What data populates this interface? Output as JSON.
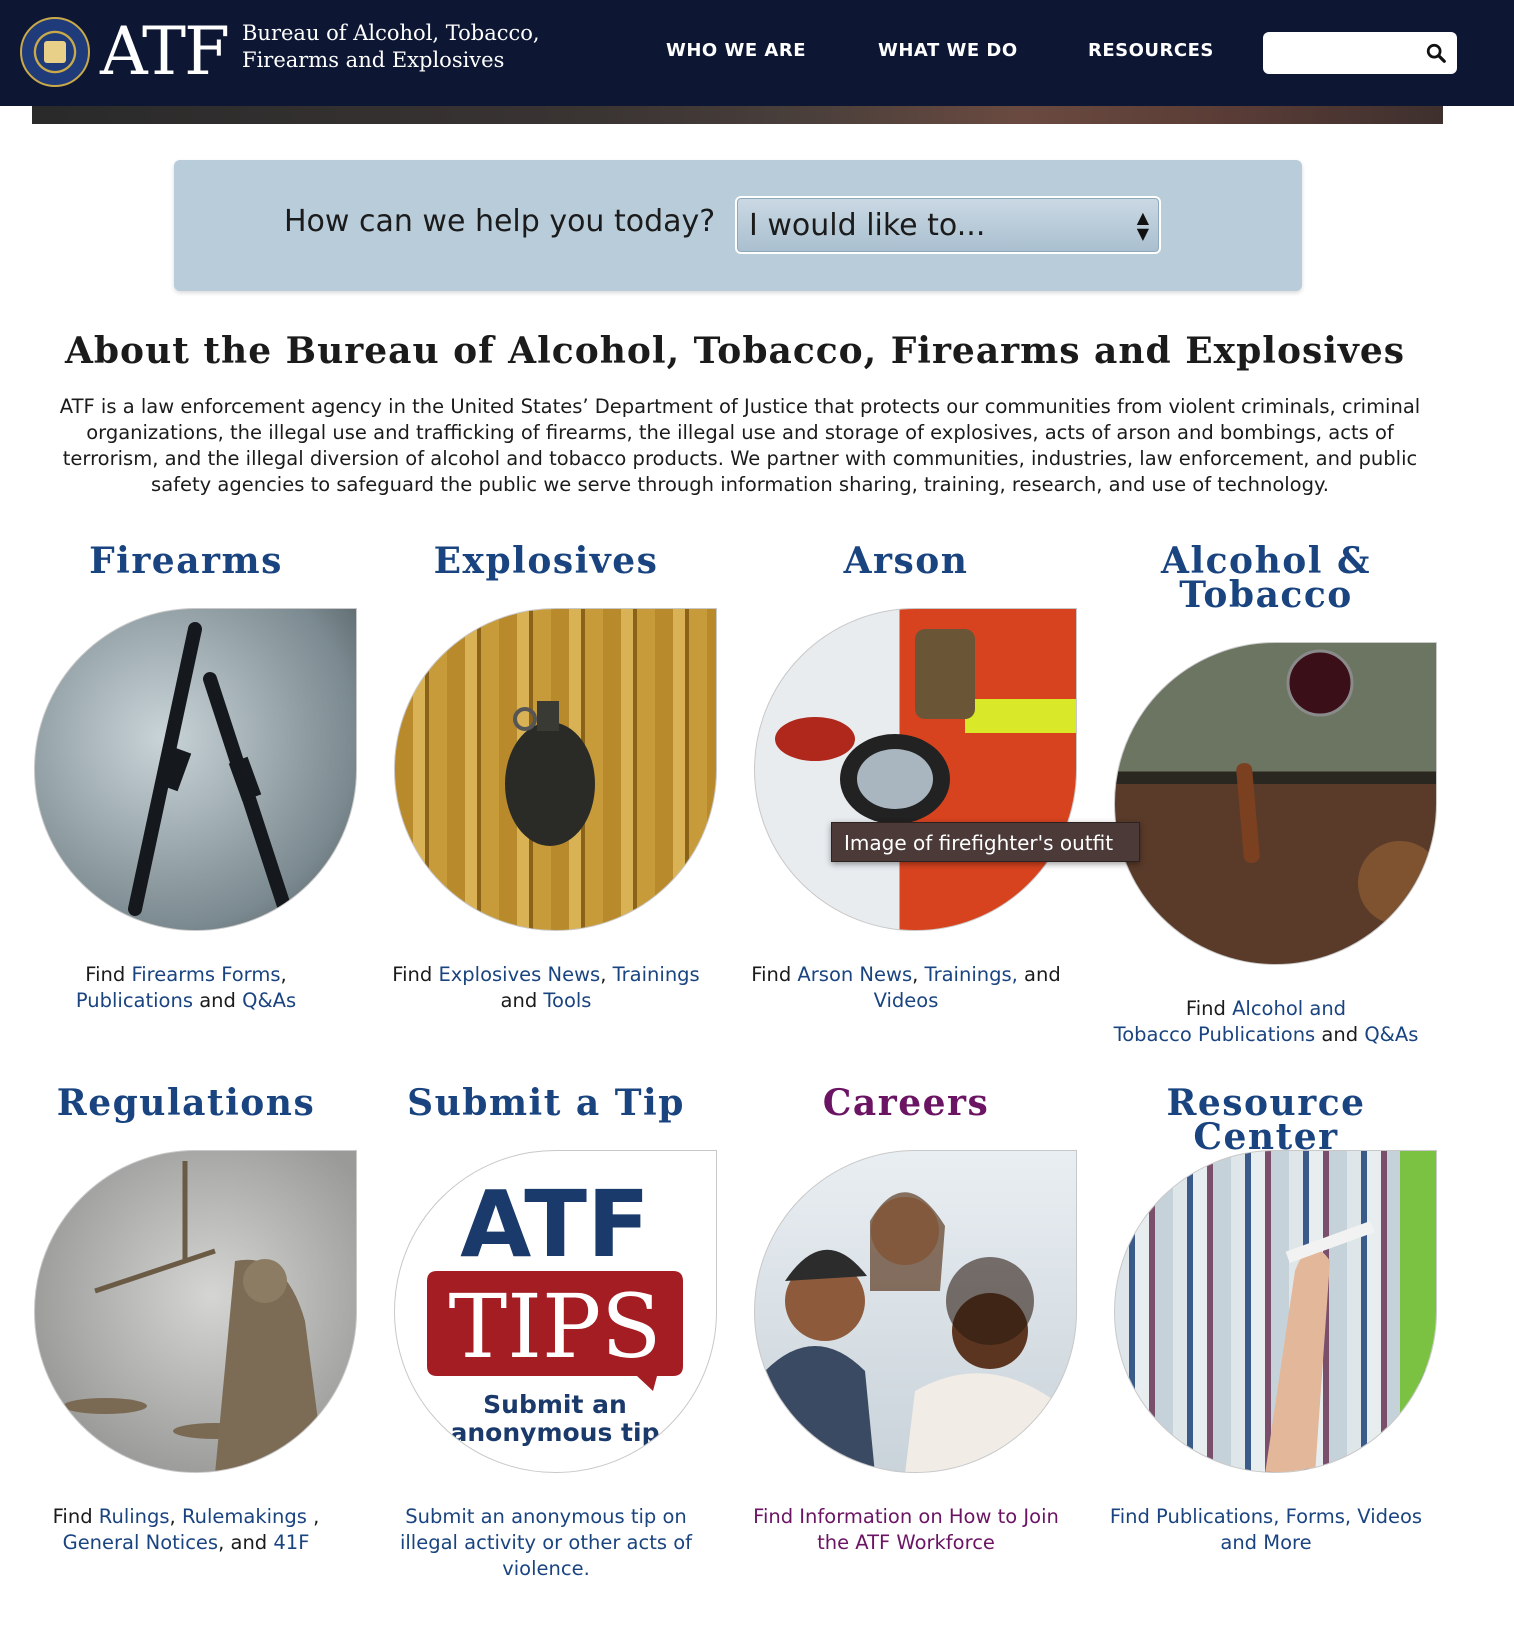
{
  "header": {
    "logo_text": "ATF",
    "agency_line1": "Bureau of Alcohol, Tobacco,",
    "agency_line2": "Firearms and Explosives",
    "nav": [
      "WHO WE ARE",
      "WHAT WE DO",
      "RESOURCES"
    ],
    "search": {
      "value": "",
      "icon": "search-icon"
    }
  },
  "help": {
    "label": "How can we help you today?",
    "select_value": "I would like to..."
  },
  "about": {
    "title": "About the Bureau of Alcohol, Tobacco, Firearms and Explosives",
    "body": "ATF is a law enforcement agency in the United States’ Department of Justice that protects our communities from violent criminals, criminal organizations, the illegal use and trafficking of firearms, the illegal use and storage of explosives, acts of arson and bombings, acts of terrorism, and the illegal diversion of alcohol and tobacco products. We partner with communities, industries, law enforcement, and public safety agencies to safeguard the public we serve through information sharing, training, research, and use of technology."
  },
  "cards": {
    "firearms": {
      "title": "Firearms",
      "find": "Find ",
      "l1": "Firearms Forms",
      "c1": ",",
      "l2": "Publications",
      "and": " and ",
      "l3": "Q&As"
    },
    "explosives": {
      "title": "Explosives",
      "find": "Find ",
      "l1": "Explosives News",
      "c1": ", ",
      "l2": "Trainings",
      "and": "and ",
      "l3": "Tools"
    },
    "arson": {
      "title": "Arson",
      "find": "Find ",
      "l1": "Arson News",
      "c1": ", ",
      "l2": "Trainings,",
      "and": " and ",
      "l3": "Videos"
    },
    "alcohol": {
      "title_line1": "Alcohol &",
      "title_line2": "Tobacco",
      "find": "Find ",
      "l1": "Alcohol and",
      "l2": "Tobacco Publications",
      "and": " and ",
      "l3": "Q&As"
    },
    "regulations": {
      "title": "Regulations",
      "find": "Find ",
      "l1": "Rulings",
      "c1": ", ",
      "l2": "Rulemakings",
      "c2": " ,",
      "l3": "General Notices",
      "c3": ", and ",
      "l4": "41F"
    },
    "tip": {
      "title": "Submit a Tip",
      "desc": "Submit an anonymous tip on illegal activity or other acts of violence.",
      "img_atf": "ATF",
      "img_tips": "TIPS",
      "img_sub1": "Submit an",
      "img_sub2": "anonymous tip"
    },
    "careers": {
      "title": "Careers",
      "desc": "Find Information on How to Join the ATF Workforce"
    },
    "resource": {
      "title": "Resource Center",
      "desc": "Find Publications, Forms, Videos and More"
    }
  },
  "tooltip": {
    "text": "Image of firefighter's outfit"
  },
  "colors": {
    "header_bg": "#0d1733",
    "link": "#1a4480",
    "purple": "#6b1463",
    "help_bg": "#b8ccda"
  }
}
